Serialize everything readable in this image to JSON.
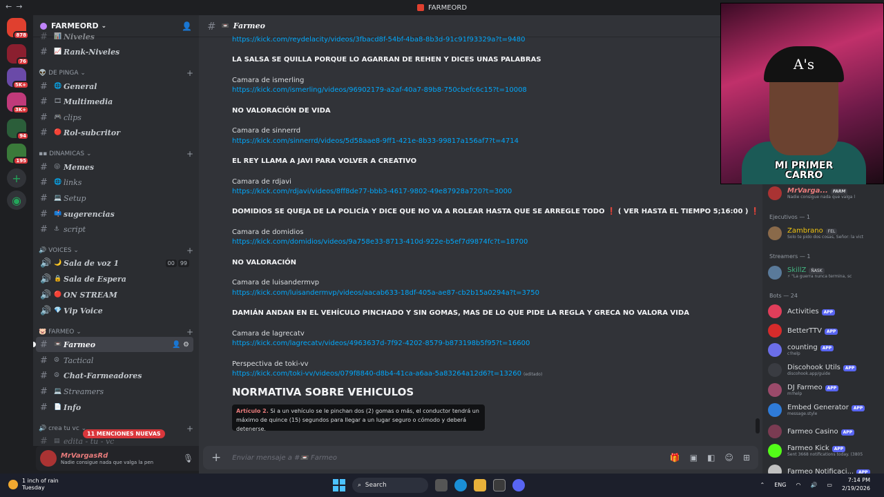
{
  "window": {
    "title": "FARMEORD"
  },
  "rail": {
    "badges": [
      "878",
      "76",
      "5K+",
      "3K+",
      "94",
      "195"
    ]
  },
  "sidebar": {
    "guild_name": "FARMEORD",
    "top_channels": [
      {
        "name": "Niveles",
        "emoji": "📊"
      },
      {
        "name": "Rank-Niveles",
        "emoji": "📈"
      }
    ],
    "categories": {
      "de_pinga": "DE PINGA",
      "dinamicas": "DINAMICAS",
      "voices": "VOICES",
      "farmeo": "FARMEO",
      "crea_tu_vc": "crea tu vc"
    },
    "de_pinga_channels": [
      {
        "name": "General",
        "emoji": "🌐"
      },
      {
        "name": "Multimedia",
        "emoji": "🎞"
      },
      {
        "name": "clips",
        "emoji": "🎮"
      },
      {
        "name": "Rol-subcritor",
        "emoji": "🔴"
      }
    ],
    "dinamicas_channels": [
      {
        "name": "Memes",
        "emoji": "😜"
      },
      {
        "name": "links",
        "emoji": "🌐"
      },
      {
        "name": "Setup",
        "emoji": "💻"
      },
      {
        "name": "sugerencias",
        "emoji": "📫"
      },
      {
        "name": "script",
        "emoji": "⚓"
      }
    ],
    "voice_channels": [
      {
        "name": "Sala de voz 1",
        "emoji": "🌙",
        "c1": "00",
        "c2": "99"
      },
      {
        "name": "Sala de Espera",
        "emoji": "🔒"
      },
      {
        "name": "ON STREAM",
        "emoji": "🔴"
      },
      {
        "name": "Vip Voice",
        "emoji": "💎"
      }
    ],
    "farmeo_channels": [
      {
        "name": "Farmeo",
        "emoji": "📼"
      },
      {
        "name": "Tactical",
        "emoji": "☮"
      },
      {
        "name": "Chat-Farmeadores",
        "emoji": "☮"
      },
      {
        "name": "Streamers",
        "emoji": "💻"
      },
      {
        "name": "Info",
        "emoji": "📄"
      }
    ],
    "last_channel": "edita - tu - vc",
    "mentions": "11 MENCIONES NUEVAS"
  },
  "user": {
    "name": "MrVargasRd",
    "status": "Nadie consigue nada que valga la pen"
  },
  "chat": {
    "channel": "Farmeo",
    "messages": [
      {
        "type": "link",
        "text": "https://kick.com/reydelacity/videos/3fbacd8f-54bf-4ba8-8b3d-91c91f93329a?t=9480"
      },
      {
        "type": "bold",
        "text": "LA SALSA SE QUILLA PORQUE LO AGARRAN DE REHEN Y DICES UNAS PALABRAS"
      },
      {
        "type": "plain",
        "text": "Camara de ismerling"
      },
      {
        "type": "link",
        "text": "https://kick.com/ismerling/videos/96902179-a2af-40a7-89b8-750cbefc6c15?t=10008"
      },
      {
        "type": "bold",
        "text": "NO VALORACIÓN DE VIDA"
      },
      {
        "type": "plain",
        "text": "Camara de sinnerrd"
      },
      {
        "type": "link",
        "text": "https://kick.com/sinnerrd/videos/5d58aae8-9ff1-421e-8b33-99817a156af7?t=4714"
      },
      {
        "type": "bold",
        "text": "EL REY LLAMA A JAVI PARA VOLVER A CREATIVO"
      },
      {
        "type": "plain",
        "text": "Camara de rdjavi"
      },
      {
        "type": "link",
        "text": "https://kick.com/rdjavi/videos/8ff8de77-bbb3-4617-9802-49e87928a720?t=3000"
      },
      {
        "type": "bold",
        "text": "DOMIDIOS SE QUEJA DE LA POLICÍA Y DICE QUE NO VA A ROLEAR HASTA QUE SE ARREGLE TODO ❗ ( VER HASTA EL TIEMPO 5;16:00 ) ❗"
      },
      {
        "type": "plain",
        "text": "Camara de domidios"
      },
      {
        "type": "link",
        "text": "https://kick.com/domidios/videos/9a758e33-8713-410d-922e-b5ef7d9874fc?t=18700"
      },
      {
        "type": "bold",
        "text": "NO VALORACIÓN"
      },
      {
        "type": "plain",
        "text": "Camara de luisandermvp"
      },
      {
        "type": "link",
        "text": "https://kick.com/luisandermvp/videos/aacab633-18df-405a-ae87-cb2b15a0294a?t=3750"
      },
      {
        "type": "bold",
        "text": "DAMIÁN ANDAN EN EL VEHÍCULO PINCHADO Y SIN GOMAS, MAS DE LO QUE PIDE LA REGLA Y GRECA NO VALORA VIDA"
      },
      {
        "type": "plain",
        "text": "Camara de lagrecatv"
      },
      {
        "type": "link",
        "text": "https://kick.com/lagrecatv/videos/4963637d-7f92-4202-8579-b873198b5f95?t=16600"
      },
      {
        "type": "plain",
        "text": "Perspectiva de toki-vv"
      },
      {
        "type": "link",
        "text": "https://kick.com/toki-vv/videos/079f8840-d8b4-41ca-a6aa-5a83264a12d6?t=13260",
        "note": "(editado)"
      }
    ],
    "heading": "NORMATIVA SOBRE VEHICULOS",
    "embed": {
      "article": "Artículo 2.",
      "text": "Si a un vehículo se le pinchan dos (2) gomas o más, el conductor tendrá un máximo de quince (15) segundos para llegar a un lugar seguro o cómodo y deberá detenerse."
    },
    "composer_placeholder": "Enviar mensaje a #📼 Farmeo"
  },
  "webcam": {
    "caption": "MI PRIMER CARRO",
    "cap_text": "A's"
  },
  "members": {
    "top_member": {
      "name": "MrVarga...",
      "role": "FARM",
      "sub": "Nadie consigue nada que valga l"
    },
    "sections": {
      "ejecutivos": "Ejecutivos — 1",
      "streamers": "Streamers — 1",
      "bots": "Bots — 24"
    },
    "ejecutivos": [
      {
        "name": "Zambrano",
        "role": "FEL",
        "sub": "Solo te pido dos cosas, Señor: la vict"
      }
    ],
    "streamers": [
      {
        "name": "SkillZ",
        "role": "ÑASK",
        "sub": "⚡ \"La guerra nunca termina, sc"
      }
    ],
    "bots": [
      {
        "name": "Activities",
        "sub": "",
        "color": "#e03e5a"
      },
      {
        "name": "BetterTTV",
        "sub": "",
        "color": "#d62b2b"
      },
      {
        "name": "counting",
        "sub": "c!help",
        "color": "#6b6ee8"
      },
      {
        "name": "Discohook Utils",
        "sub": "discohook.app/guide",
        "color": "#3a3c42"
      },
      {
        "name": "DJ Farmeo",
        "sub": "m!help",
        "color": "#9b4a6a"
      },
      {
        "name": "Embed Generator",
        "sub": "message.style",
        "color": "#2f7bd8"
      },
      {
        "name": "Farmeo Casino",
        "sub": "",
        "color": "#7a3b52"
      },
      {
        "name": "Farmeo Kick",
        "sub": "Sent 3668 notifications today. (3805",
        "color": "#53fc18"
      },
      {
        "name": "Farmeo Notificaci...",
        "sub": "",
        "color": "#c0c0c0"
      }
    ],
    "app_label": "APP"
  },
  "taskbar": {
    "weather_title": "1 inch of rain",
    "weather_day": "Tuesday",
    "search": "Search",
    "lang": "ENG",
    "time": "7:14 PM",
    "date": "2/19/2026"
  }
}
